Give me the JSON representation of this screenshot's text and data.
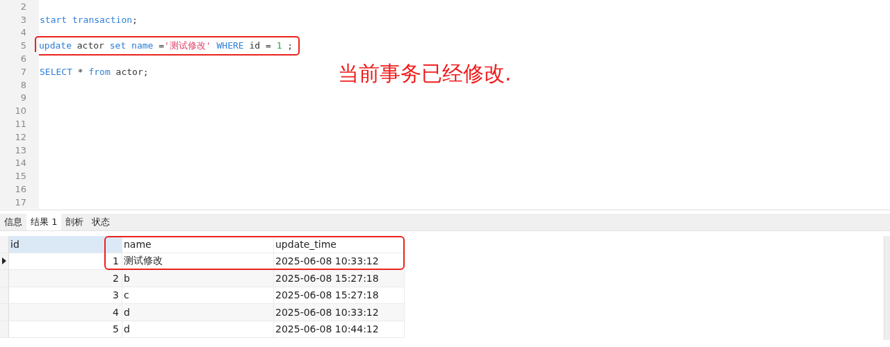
{
  "editor": {
    "lines": [
      {
        "number": "2"
      },
      {
        "number": "3",
        "tokens": [
          {
            "text": "start transaction",
            "kind": "keyword"
          },
          {
            "text": ";",
            "kind": "plain"
          }
        ]
      },
      {
        "number": "4"
      },
      {
        "number": "5",
        "highlighted": true,
        "tokens": [
          {
            "text": "update",
            "kind": "keyword"
          },
          {
            "text": " actor ",
            "kind": "plain"
          },
          {
            "text": "set name",
            "kind": "keyword"
          },
          {
            "text": " =",
            "kind": "plain"
          },
          {
            "text": "'测试修改'",
            "kind": "string"
          },
          {
            "text": " WHERE",
            "kind": "keyword"
          },
          {
            "text": " id = ",
            "kind": "plain"
          },
          {
            "text": "1",
            "kind": "number"
          },
          {
            "text": " ;",
            "kind": "plain"
          }
        ]
      },
      {
        "number": "6"
      },
      {
        "number": "7",
        "tokens": [
          {
            "text": "SELECT",
            "kind": "keyword"
          },
          {
            "text": " * ",
            "kind": "plain"
          },
          {
            "text": "from",
            "kind": "keyword"
          },
          {
            "text": " actor;",
            "kind": "plain"
          }
        ]
      },
      {
        "number": "8"
      },
      {
        "number": "9"
      },
      {
        "number": "10"
      },
      {
        "number": "11"
      },
      {
        "number": "12"
      },
      {
        "number": "13"
      },
      {
        "number": "14"
      },
      {
        "number": "15"
      },
      {
        "number": "16"
      },
      {
        "number": "17"
      }
    ],
    "annotation": "当前事务已经修改."
  },
  "tabs": [
    {
      "label": "信息",
      "selected": false
    },
    {
      "label": "结果 1",
      "selected": true
    },
    {
      "label": "剖析",
      "selected": false
    },
    {
      "label": "状态",
      "selected": false
    }
  ],
  "grid": {
    "columns": [
      "id",
      "name",
      "update_time"
    ],
    "highlight_header_and_first_row": true,
    "rows": [
      {
        "selected": true,
        "cells": [
          "1",
          "测试修改",
          "2025-06-08 10:33:12"
        ]
      },
      {
        "selected": false,
        "cells": [
          "2",
          "b",
          "2025-06-08 15:27:18"
        ]
      },
      {
        "selected": false,
        "cells": [
          "3",
          "c",
          "2025-06-08 15:27:18"
        ]
      },
      {
        "selected": false,
        "cells": [
          "4",
          "d",
          "2025-06-08 10:33:12"
        ]
      },
      {
        "selected": false,
        "cells": [
          "5",
          "d",
          "2025-06-08 10:44:12"
        ]
      }
    ]
  }
}
